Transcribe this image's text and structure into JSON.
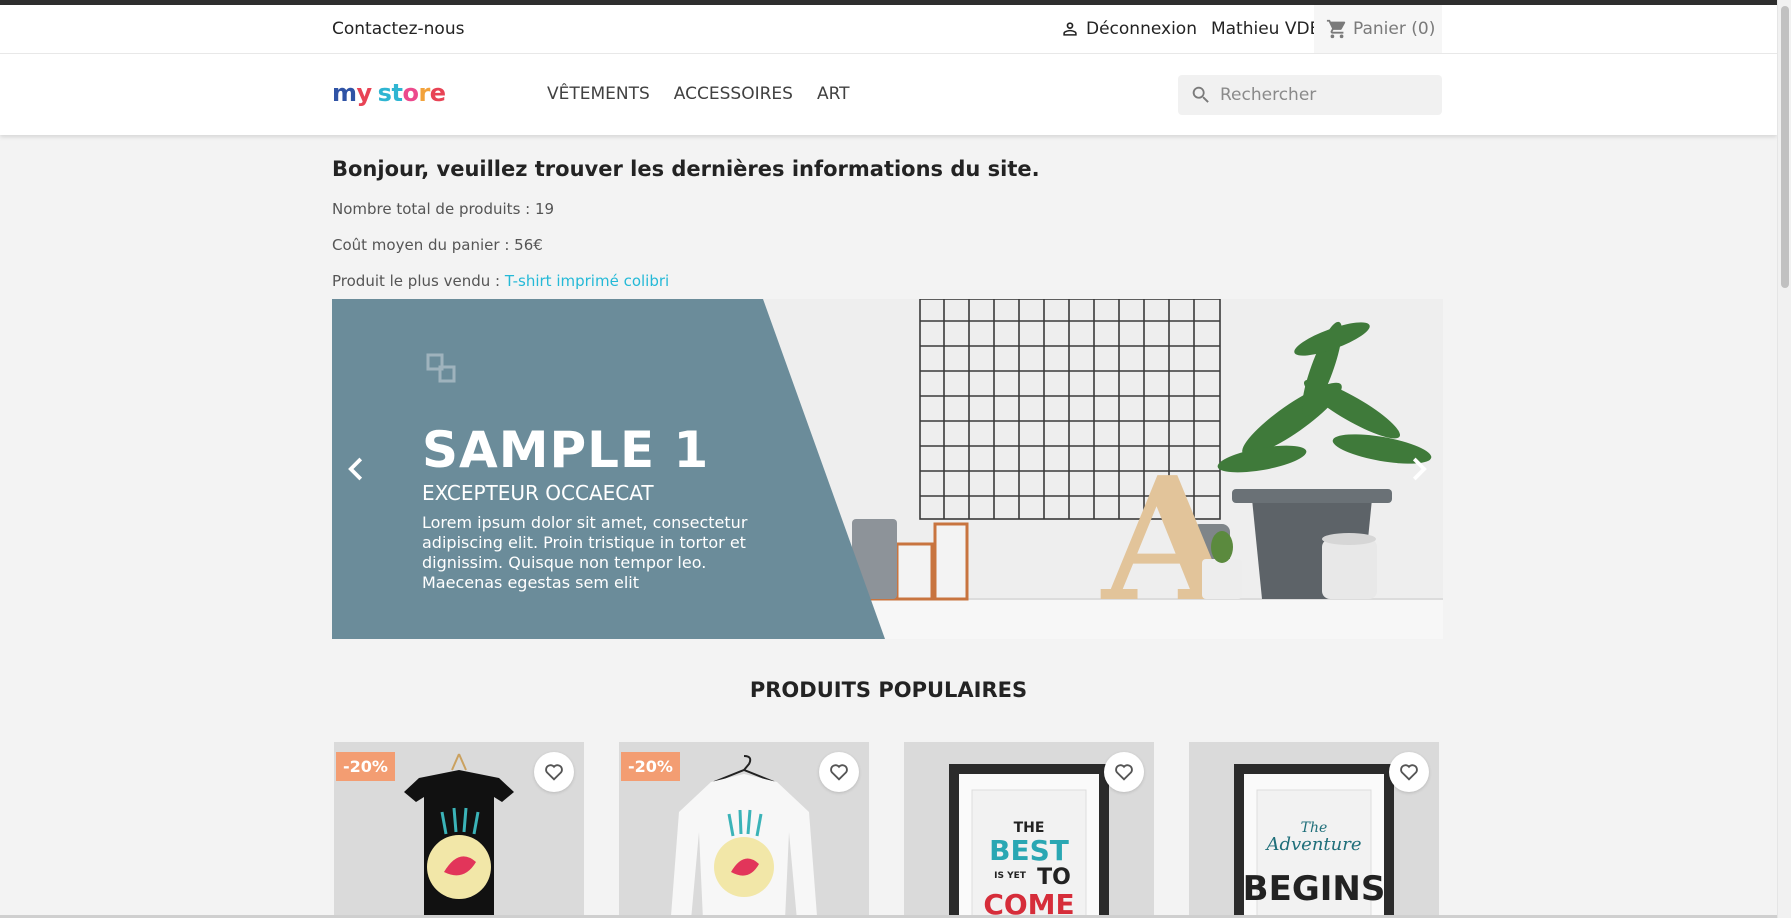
{
  "header": {
    "contact_label": "Contactez-nous",
    "logout_label": "Déconnexion",
    "user_name": "Mathieu VDB",
    "cart_label": "Panier",
    "cart_count": "(0)"
  },
  "logo": {
    "letters": [
      "m",
      "y",
      " ",
      "s",
      "t",
      "o",
      "r",
      "e"
    ],
    "colors": [
      "#2f53a5",
      "#e84355",
      "#ffffff",
      "#2fb5d2",
      "#2fb5d2",
      "#ec4a8d",
      "#f2a23b",
      "#e84355"
    ]
  },
  "menu": {
    "items": [
      "VÊTEMENTS",
      "ACCESSOIRES",
      "ART"
    ]
  },
  "search": {
    "placeholder": "Rechercher"
  },
  "info": {
    "title": "Bonjour, veuillez trouver les dernières informations du site.",
    "total_label": "Nombre total de produits : 19",
    "avg_label": "Coût moyen du panier : 56€",
    "best_prefix": "Produit le plus vendu : ",
    "best_link": "T-shirt imprimé colibri"
  },
  "slider": {
    "title": "SAMPLE 1",
    "subtitle": "EXCEPTEUR OCCAECAT",
    "text": "Lorem ipsum dolor sit amet, consectetur adipiscing elit. Proin tristique in tortor et dignissim. Quisque non tempor leo. Maecenas egestas sem elit",
    "panel_color": "#6b8c9a",
    "letter": "A"
  },
  "popular": {
    "title": "PRODUITS POPULAIRES",
    "products": [
      {
        "badge": "-20%",
        "kind": "black-tshirt"
      },
      {
        "badge": "-20%",
        "kind": "white-sweater"
      },
      {
        "badge": "",
        "kind": "poster-best"
      },
      {
        "badge": "",
        "kind": "poster-adventure"
      }
    ],
    "poster_best_lines": [
      "THE",
      "BEST",
      "IS YET",
      "TO",
      "COME"
    ],
    "poster_adventure_lines": [
      "The",
      "Adventure",
      "BEGINS"
    ]
  },
  "icons": {
    "user": "user-icon",
    "cart": "cart-icon",
    "search": "search-icon",
    "prev": "chevron-left-icon",
    "next": "chevron-right-icon",
    "wish": "heart-icon"
  }
}
